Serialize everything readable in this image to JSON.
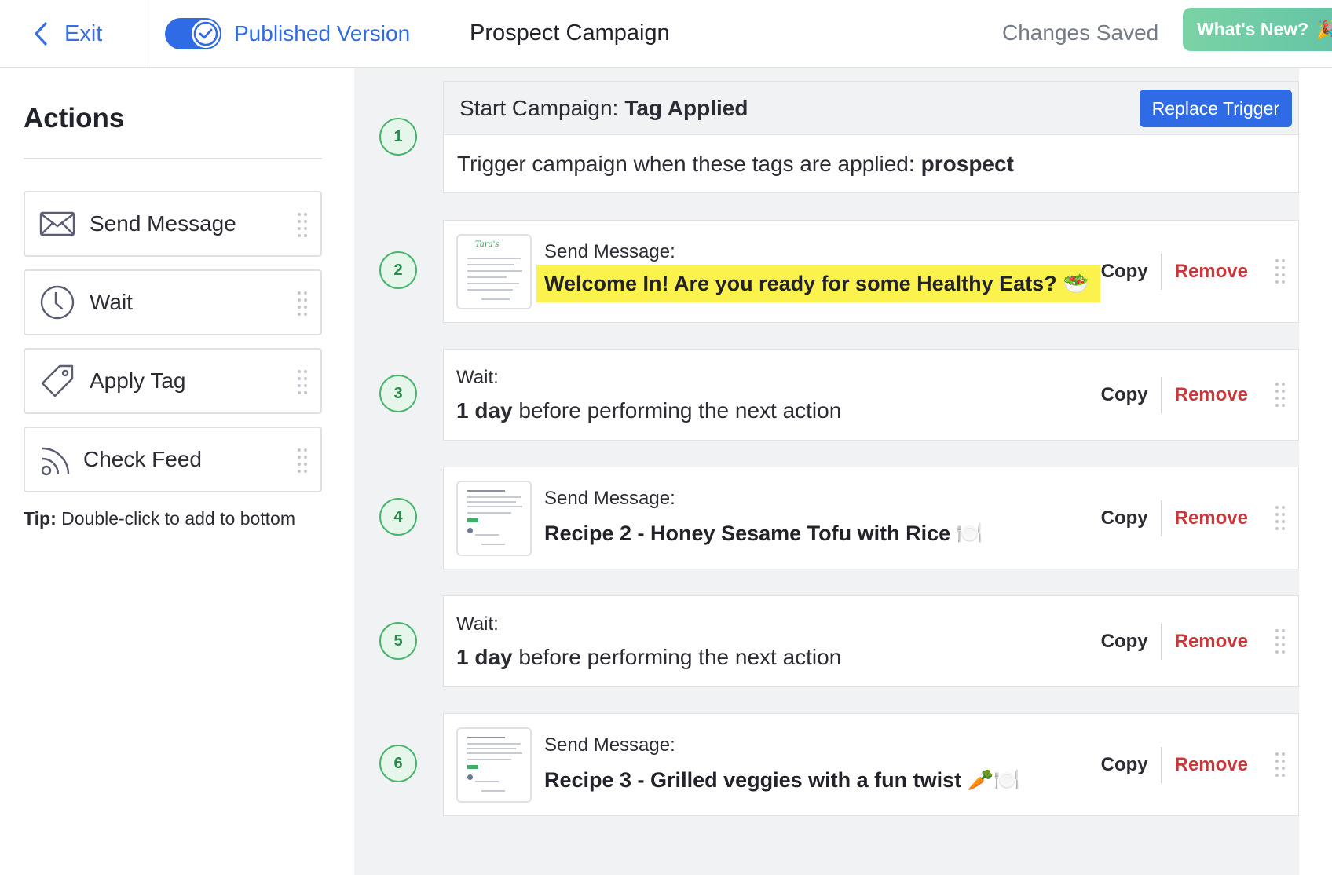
{
  "header": {
    "exit_label": "Exit",
    "toggle_label": "Published Version",
    "campaign_title": "Prospect Campaign",
    "status": "Changes Saved",
    "whats_new_label": "What's New?",
    "whats_new_emoji": "🎉"
  },
  "sidebar": {
    "title": "Actions",
    "items": [
      {
        "label": "Send Message",
        "icon": "envelope-icon"
      },
      {
        "label": "Wait",
        "icon": "clock-icon"
      },
      {
        "label": "Apply Tag",
        "icon": "tag-icon"
      },
      {
        "label": "Check Feed",
        "icon": "rss-feed-icon"
      }
    ],
    "tip_bold": "Tip:",
    "tip_text": "Double-click to add to bottom"
  },
  "steps": {
    "s1": {
      "number": "1",
      "head_prefix": "Start Campaign:",
      "head_bold": "Tag Applied",
      "replace_label": "Replace Trigger",
      "body_text": "Trigger campaign when these tags are applied:",
      "body_bold": "prospect"
    },
    "s2": {
      "number": "2",
      "label": "Send Message:",
      "title": "Welcome In! Are you ready for some Healthy Eats?",
      "emoji": "🥗"
    },
    "s3": {
      "number": "3",
      "label": "Wait:",
      "duration": "1 day",
      "rest": "before performing the next action"
    },
    "s4": {
      "number": "4",
      "label": "Send Message:",
      "title": "Recipe 2 - Honey Sesame Tofu with Rice",
      "emoji": "🍽️"
    },
    "s5": {
      "number": "5",
      "label": "Wait:",
      "duration": "1 day",
      "rest": "before performing the next action"
    },
    "s6": {
      "number": "6",
      "label": "Send Message:",
      "title": "Recipe 3 - Grilled veggies with a fun twist",
      "emoji": "🥕🍽️"
    }
  },
  "card_actions": {
    "copy_label": "Copy",
    "remove_label": "Remove"
  },
  "colors": {
    "accent": "#2f6be4",
    "remove": "#c8383b",
    "step_green": "#48b46d",
    "highlight": "#fbf24d"
  }
}
